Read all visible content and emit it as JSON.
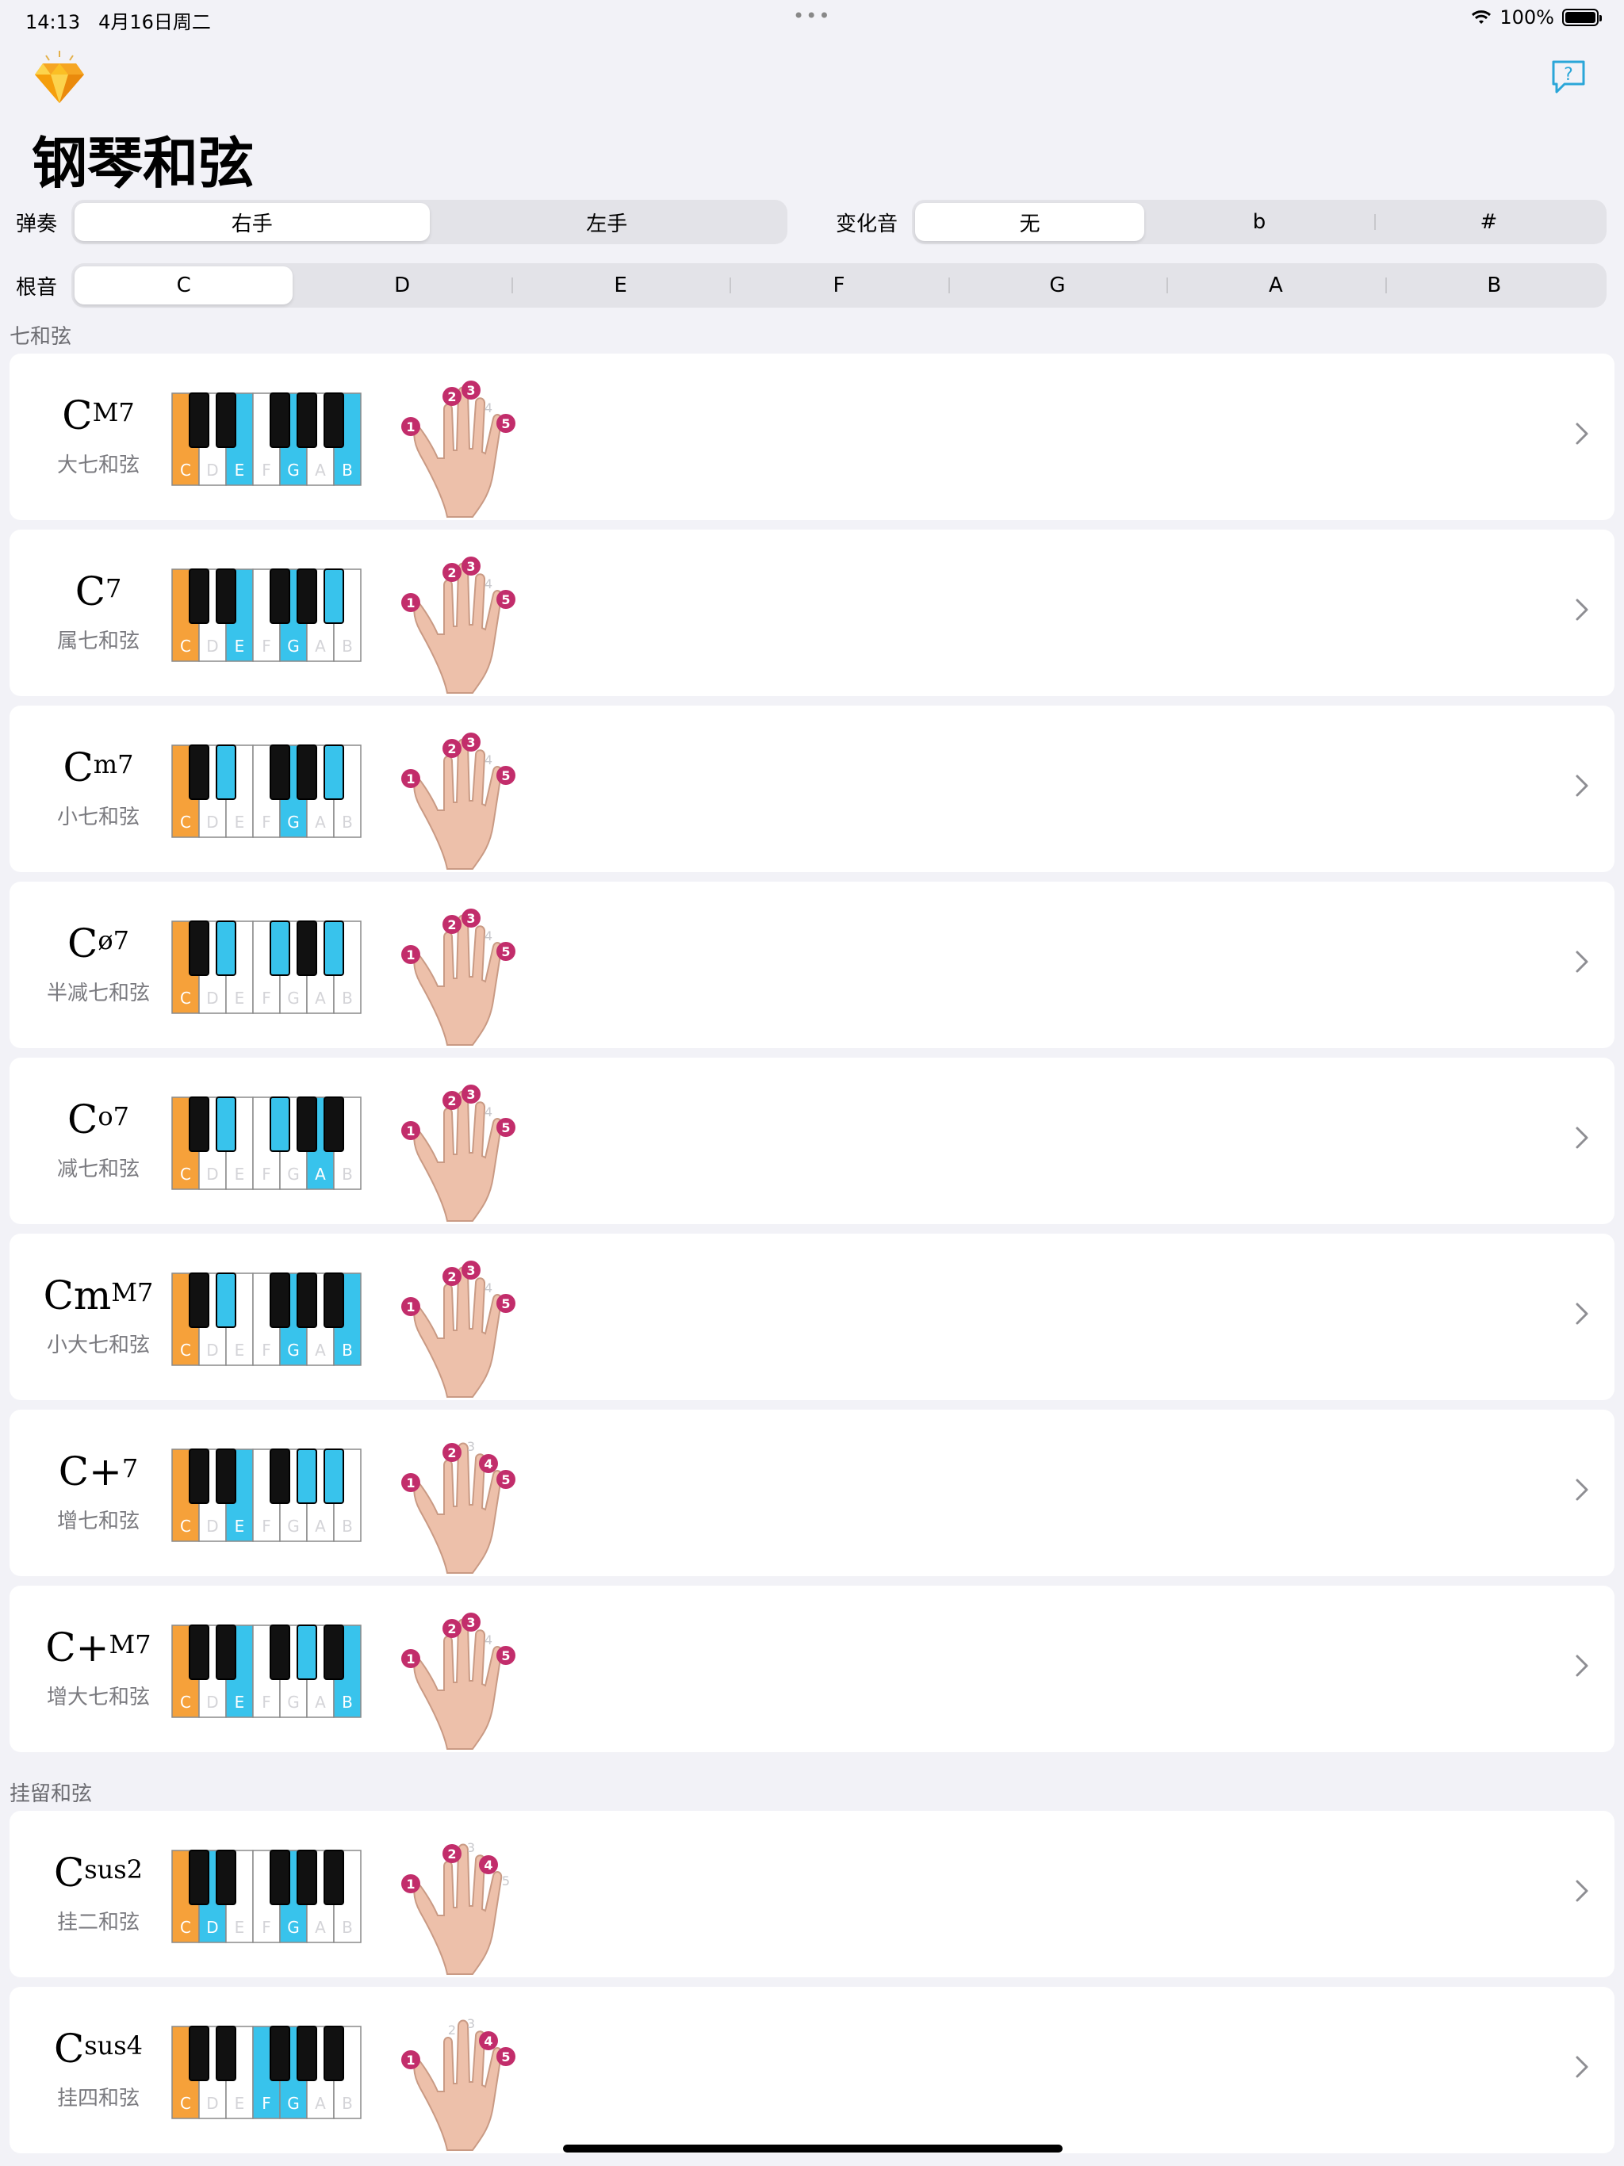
{
  "status": {
    "time": "14:13",
    "date": "4月16日周二",
    "dots": "•••",
    "battery": "100%"
  },
  "app": {
    "title": "钢琴和弦",
    "logo_icon": "diamond-logo-icon",
    "help_icon": "help-bubble-icon"
  },
  "play": {
    "label": "弹奏",
    "options": [
      "右手",
      "左手"
    ],
    "selected": 0
  },
  "accidental": {
    "label": "变化音",
    "options": [
      "无",
      "b",
      "#"
    ],
    "selected": 0
  },
  "root": {
    "label": "根音",
    "options": [
      "C",
      "D",
      "E",
      "F",
      "G",
      "A",
      "B"
    ],
    "selected": 0
  },
  "colors": {
    "root": "#f6a13a",
    "chord": "#38c3ec",
    "finger": "#c22d6b"
  },
  "sections": [
    {
      "title": "七和弦",
      "chords": [
        {
          "base": "C",
          "sup": "M7",
          "name": "大七和弦",
          "white": [
            "root",
            "",
            "chord",
            "",
            "chord",
            "",
            "chord"
          ],
          "black": [
            "",
            "",
            "",
            "",
            ""
          ],
          "fingers": [
            1,
            2,
            3,
            5
          ]
        },
        {
          "base": "C",
          "sup": "7",
          "name": "属七和弦",
          "white": [
            "root",
            "",
            "chord",
            "",
            "chord",
            "",
            ""
          ],
          "black": [
            "",
            "",
            "",
            "",
            "chord"
          ],
          "fingers": [
            1,
            2,
            3,
            5
          ]
        },
        {
          "base": "C",
          "sup": "m7",
          "name": "小七和弦",
          "white": [
            "root",
            "",
            "",
            "",
            "chord",
            "",
            ""
          ],
          "black": [
            "",
            "chord",
            "",
            "",
            "chord"
          ],
          "fingers": [
            1,
            2,
            3,
            5
          ]
        },
        {
          "base": "C",
          "sup": "ø7",
          "name": "半减七和弦",
          "white": [
            "root",
            "",
            "",
            "",
            "",
            "",
            ""
          ],
          "black": [
            "",
            "chord",
            "chord",
            "",
            "chord"
          ],
          "fingers": [
            1,
            2,
            3,
            5
          ]
        },
        {
          "base": "C",
          "sup": "o7",
          "name": "减七和弦",
          "white": [
            "root",
            "",
            "",
            "",
            "",
            "chord",
            ""
          ],
          "black": [
            "",
            "chord",
            "chord",
            "",
            ""
          ],
          "fingers": [
            1,
            2,
            3,
            5
          ]
        },
        {
          "base": "Cm",
          "sup": "M7",
          "name": "小大七和弦",
          "white": [
            "root",
            "",
            "",
            "",
            "chord",
            "",
            "chord"
          ],
          "black": [
            "",
            "chord",
            "",
            "",
            ""
          ],
          "fingers": [
            1,
            2,
            3,
            5
          ]
        },
        {
          "base": "C+",
          "sup": "7",
          "name": "增七和弦",
          "white": [
            "root",
            "",
            "chord",
            "",
            "",
            "",
            ""
          ],
          "black": [
            "",
            "",
            "",
            "chord",
            "chord"
          ],
          "fingers": [
            1,
            2,
            4,
            5
          ]
        },
        {
          "base": "C+",
          "sup": "M7",
          "name": "增大七和弦",
          "white": [
            "root",
            "",
            "chord",
            "",
            "",
            "",
            "chord"
          ],
          "black": [
            "",
            "",
            "",
            "chord",
            ""
          ],
          "fingers": [
            1,
            2,
            3,
            5
          ]
        }
      ]
    },
    {
      "title": "挂留和弦",
      "chords": [
        {
          "base": "C",
          "sup": "sus2",
          "name": "挂二和弦",
          "white": [
            "root",
            "chord",
            "",
            "",
            "chord",
            "",
            ""
          ],
          "black": [
            "",
            "",
            "",
            "",
            ""
          ],
          "fingers": [
            1,
            2,
            4
          ]
        },
        {
          "base": "C",
          "sup": "sus4",
          "name": "挂四和弦",
          "white": [
            "root",
            "",
            "",
            "chord",
            "chord",
            "",
            ""
          ],
          "black": [
            "",
            "",
            "",
            "",
            ""
          ],
          "fingers": [
            1,
            4,
            5
          ]
        }
      ]
    }
  ],
  "key_letters": [
    "C",
    "D",
    "E",
    "F",
    "G",
    "A",
    "B"
  ]
}
